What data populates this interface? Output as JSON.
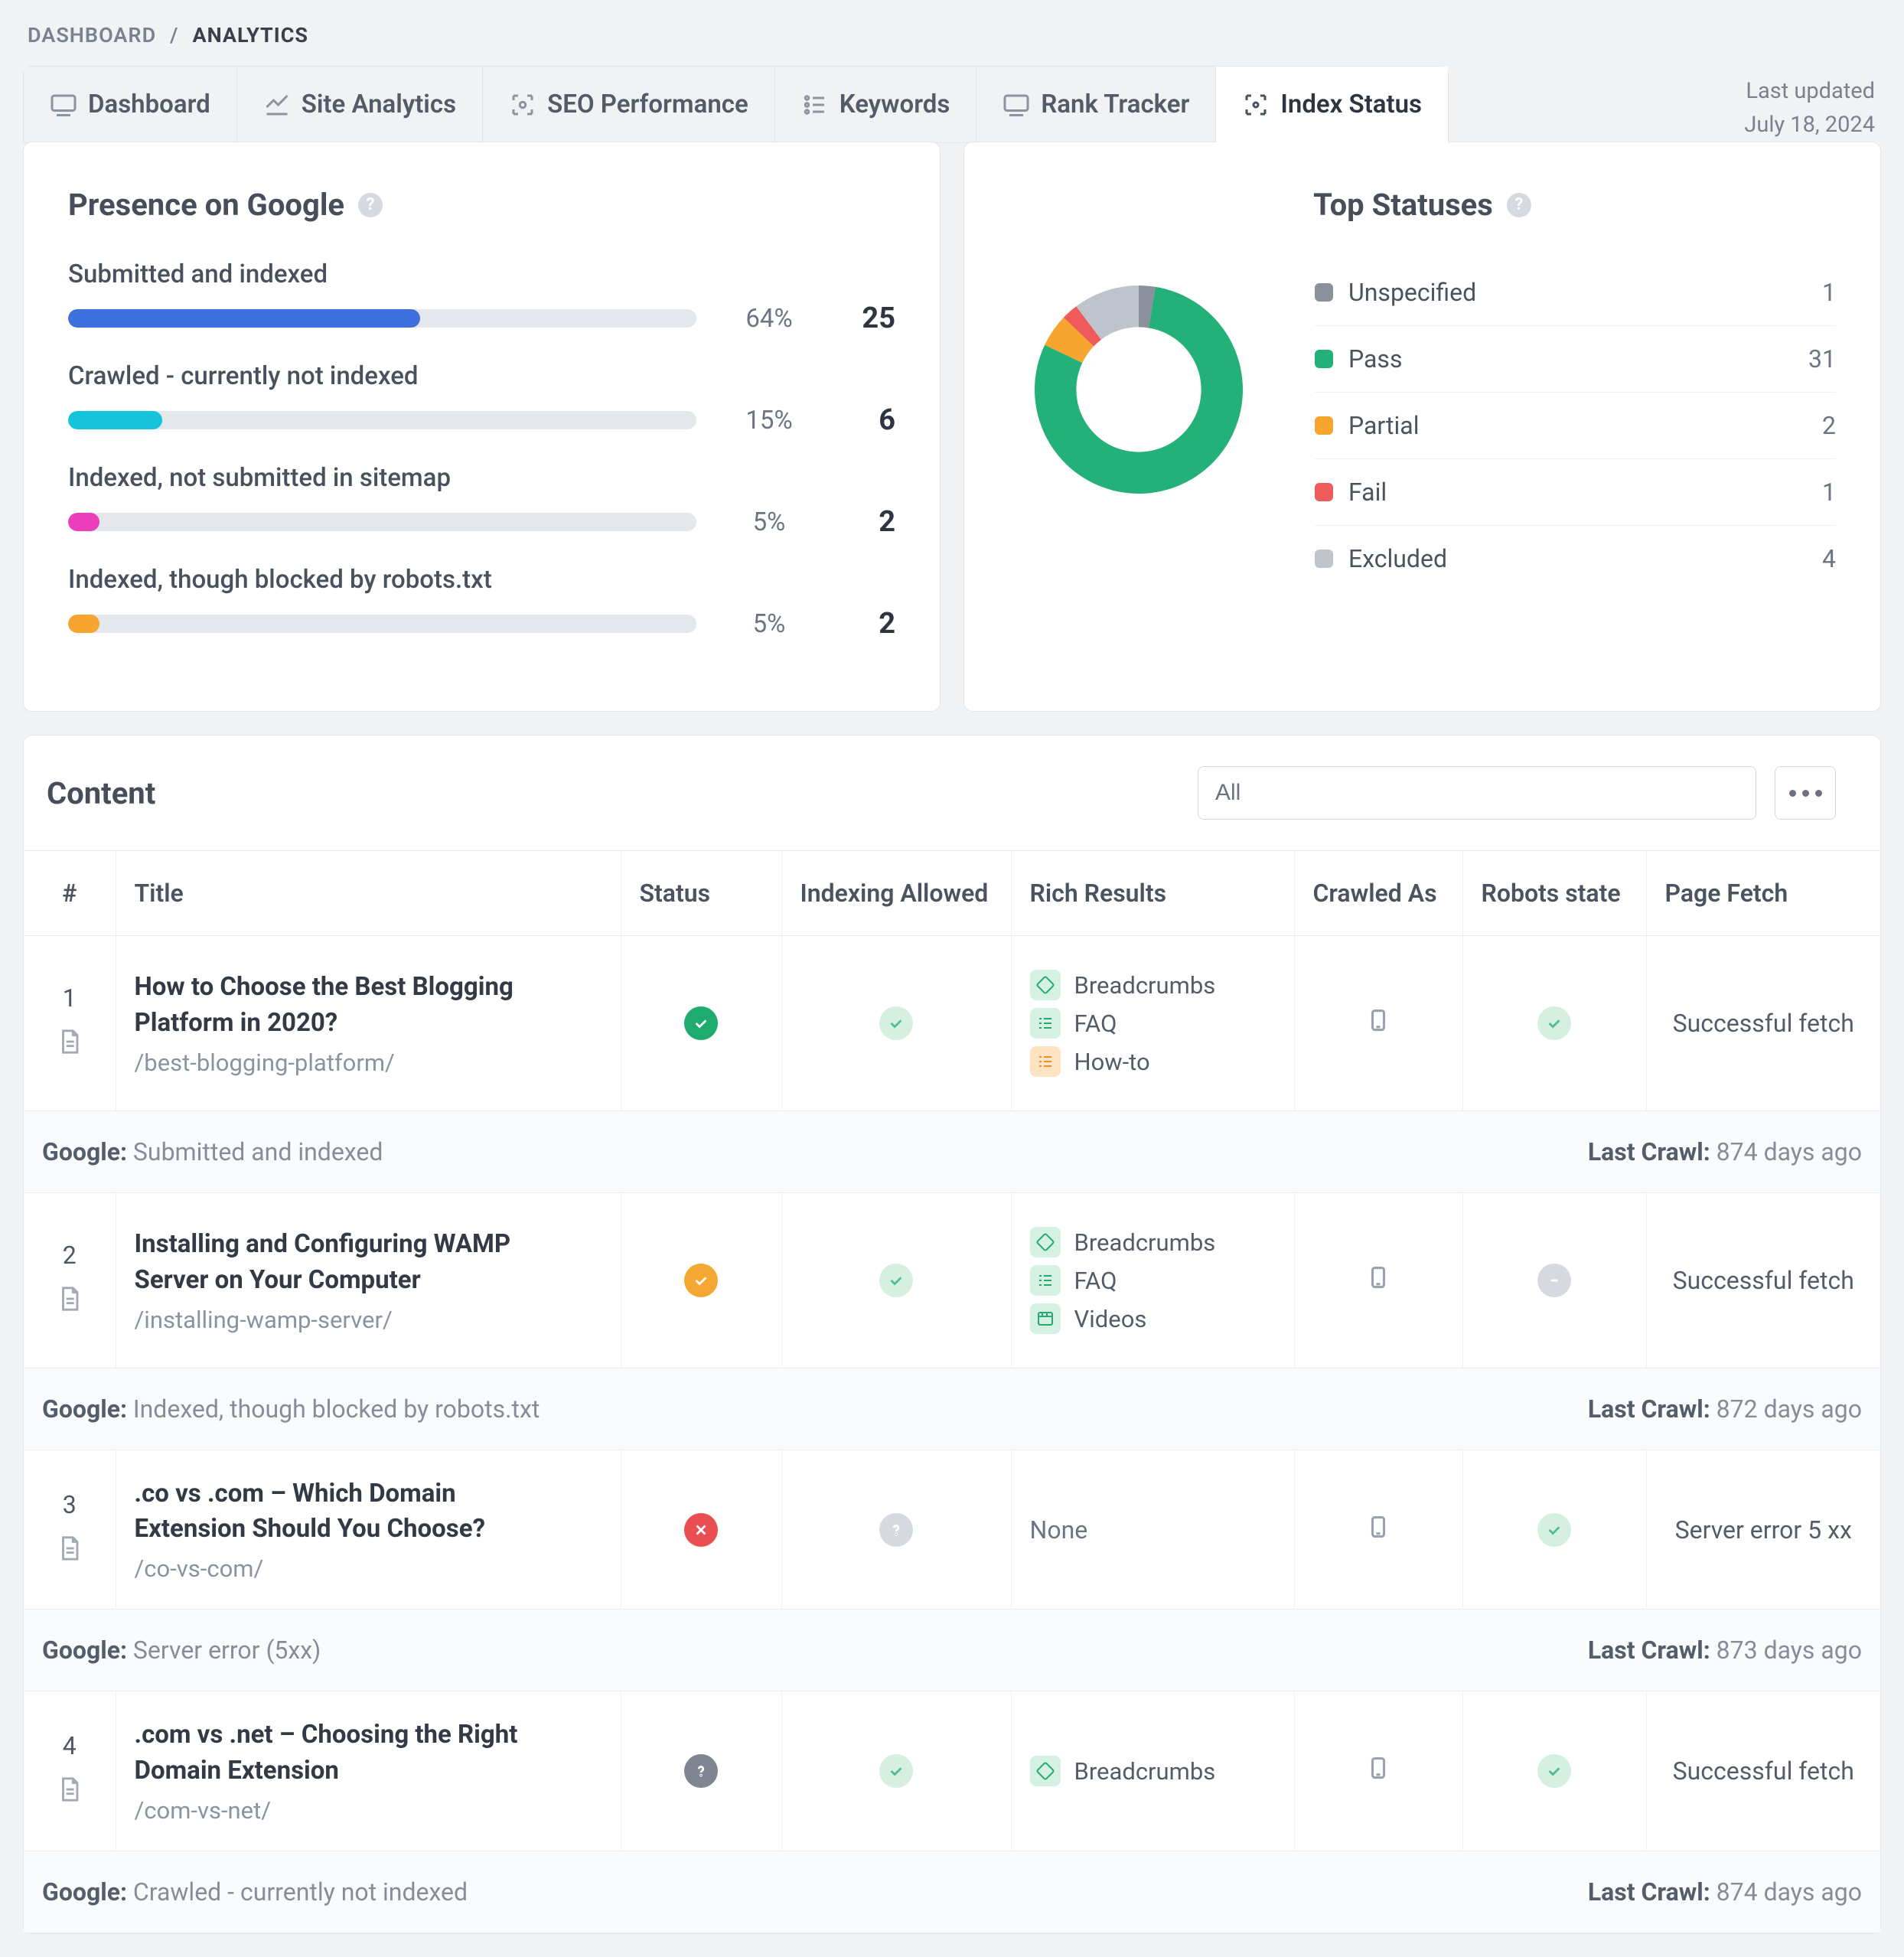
{
  "breadcrumb": {
    "root": "DASHBOARD",
    "sep": "/",
    "current": "ANALYTICS"
  },
  "tabs": [
    {
      "label": "Dashboard"
    },
    {
      "label": "Site Analytics"
    },
    {
      "label": "SEO Performance"
    },
    {
      "label": "Keywords"
    },
    {
      "label": "Rank Tracker"
    },
    {
      "label": "Index Status",
      "active": true
    }
  ],
  "last_updated": {
    "label": "Last updated",
    "value": "July 18, 2024"
  },
  "presence": {
    "title": "Presence on Google",
    "rows": [
      {
        "label": "Submitted and indexed",
        "pct": "64%",
        "value": "25",
        "width": 56,
        "color": "#3e70dd"
      },
      {
        "label": "Crawled - currently not indexed",
        "pct": "15%",
        "value": "6",
        "width": 15,
        "color": "#16c3dc"
      },
      {
        "label": "Indexed, not submitted in sitemap",
        "pct": "5%",
        "value": "2",
        "width": 5,
        "color": "#ea3ebb"
      },
      {
        "label": "Indexed, though blocked by robots.txt",
        "pct": "5%",
        "value": "2",
        "width": 5,
        "color": "#f6a52e"
      }
    ]
  },
  "top_statuses": {
    "title": "Top Statuses",
    "items": [
      {
        "label": "Unspecified",
        "value": "1",
        "color": "#8b919c"
      },
      {
        "label": "Pass",
        "value": "31",
        "color": "#23b179"
      },
      {
        "label": "Partial",
        "value": "2",
        "color": "#f6a52e"
      },
      {
        "label": "Fail",
        "value": "1",
        "color": "#ef5a5a"
      },
      {
        "label": "Excluded",
        "value": "4",
        "color": "#bfc4cc"
      }
    ]
  },
  "chart_data": {
    "type": "pie",
    "title": "Top Statuses",
    "categories": [
      "Unspecified",
      "Pass",
      "Partial",
      "Fail",
      "Excluded"
    ],
    "values": [
      1,
      31,
      2,
      1,
      4
    ],
    "colors": [
      "#8b919c",
      "#23b179",
      "#f6a52e",
      "#ef5a5a",
      "#bfc4cc"
    ]
  },
  "content": {
    "title": "Content",
    "filter_value": "All",
    "columns": {
      "idx": "#",
      "title": "Title",
      "status": "Status",
      "indexing": "Indexing Allowed",
      "rich": "Rich Results",
      "crawled_as": "Crawled As",
      "robots": "Robots state",
      "fetch": "Page Fetch"
    },
    "rows": [
      {
        "idx": "1",
        "title": "How to Choose the Best Blogging Platform in 2020?",
        "slug": "/best-blogging-platform/",
        "status": "pass",
        "indexing": "allowed",
        "rich": [
          "Breadcrumbs",
          "FAQ",
          "How-to"
        ],
        "crawled_as": "mobile",
        "robots": "allowed",
        "fetch": "Successful fetch",
        "google_label": "Google:",
        "google_status": "Submitted and indexed",
        "crawl_label": "Last Crawl:",
        "crawl_value": "874 days ago"
      },
      {
        "idx": "2",
        "title": "Installing and Configuring WAMP Server on Your Computer",
        "slug": "/installing-wamp-server/",
        "status": "partial",
        "indexing": "allowed",
        "rich": [
          "Breadcrumbs",
          "FAQ",
          "Videos"
        ],
        "crawled_as": "mobile",
        "robots": "neutral",
        "fetch": "Successful fetch",
        "google_label": "Google:",
        "google_status": "Indexed, though blocked by robots.txt",
        "crawl_label": "Last Crawl:",
        "crawl_value": "872 days ago"
      },
      {
        "idx": "3",
        "title": ".co vs .com – Which Domain Extension Should You Choose?",
        "slug": "/co-vs-com/",
        "status": "fail",
        "indexing": "unknown",
        "rich_none": "None",
        "crawled_as": "mobile",
        "robots": "allowed",
        "fetch": "Server error 5 xx",
        "google_label": "Google:",
        "google_status": "Server error (5xx)",
        "crawl_label": "Last Crawl:",
        "crawl_value": "873 days ago"
      },
      {
        "idx": "4",
        "title": ".com vs .net – Choosing the Right Domain Extension",
        "slug": "/com-vs-net/",
        "status": "unknown",
        "indexing": "allowed",
        "rich": [
          "Breadcrumbs"
        ],
        "crawled_as": "mobile",
        "robots": "allowed",
        "fetch": "Successful fetch",
        "google_label": "Google:",
        "google_status": "Crawled - currently not indexed",
        "crawl_label": "Last Crawl:",
        "crawl_value": "874 days ago"
      }
    ]
  }
}
